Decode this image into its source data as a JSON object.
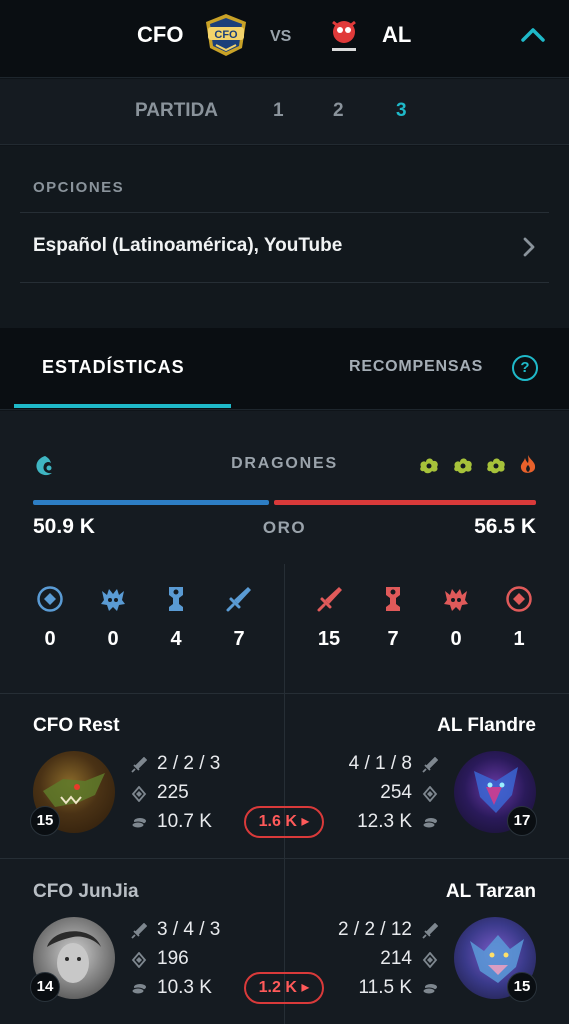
{
  "match": {
    "team_left": "CFO",
    "vs": "VS",
    "team_right": "AL"
  },
  "game_tabs": {
    "label": "PARTIDA",
    "games": [
      "1",
      "2",
      "3"
    ],
    "active": "3"
  },
  "options": {
    "title": "OPCIONES",
    "stream": "Español (Latinoamérica), YouTube"
  },
  "stat_tabs": {
    "stats": "ESTADÍSTICAS",
    "rewards": "RECOMPENSAS",
    "help": "?"
  },
  "summary": {
    "dragons_label": "DRAGONES",
    "gold_label": "ORO",
    "gold_left": "50.9 K",
    "gold_right": "56.5 K",
    "gold_share_left": 0.474,
    "left_objectives": {
      "inhibitors": "0",
      "barons": "0",
      "towers": "4",
      "kills": "7"
    },
    "right_objectives": {
      "kills": "15",
      "towers": "7",
      "barons": "0",
      "inhibitors": "1"
    }
  },
  "colors": {
    "accent": "#1fb9c9",
    "blue_team": "#2d7ec4",
    "red_team": "#d93a3a",
    "dragon_green": "#a6c23a",
    "dragon_infernal": "#e8612b"
  },
  "players": [
    {
      "left": {
        "name": "CFO Rest",
        "kda": "2 / 2 / 3",
        "cs": "225",
        "gold": "10.7 K",
        "level": "15"
      },
      "right": {
        "name": "AL Flandre",
        "kda": "4 / 1 / 8",
        "cs": "254",
        "gold": "12.3 K",
        "level": "17"
      },
      "gold_diff": "1.6 K ▸"
    },
    {
      "left": {
        "name": "CFO JunJia",
        "kda": "3 / 4 / 3",
        "cs": "196",
        "gold": "10.3 K",
        "level": "14"
      },
      "right": {
        "name": "AL Tarzan",
        "kda": "2 / 2 / 12",
        "cs": "214",
        "gold": "11.5 K",
        "level": "15"
      },
      "gold_diff": "1.2 K ▸"
    }
  ]
}
